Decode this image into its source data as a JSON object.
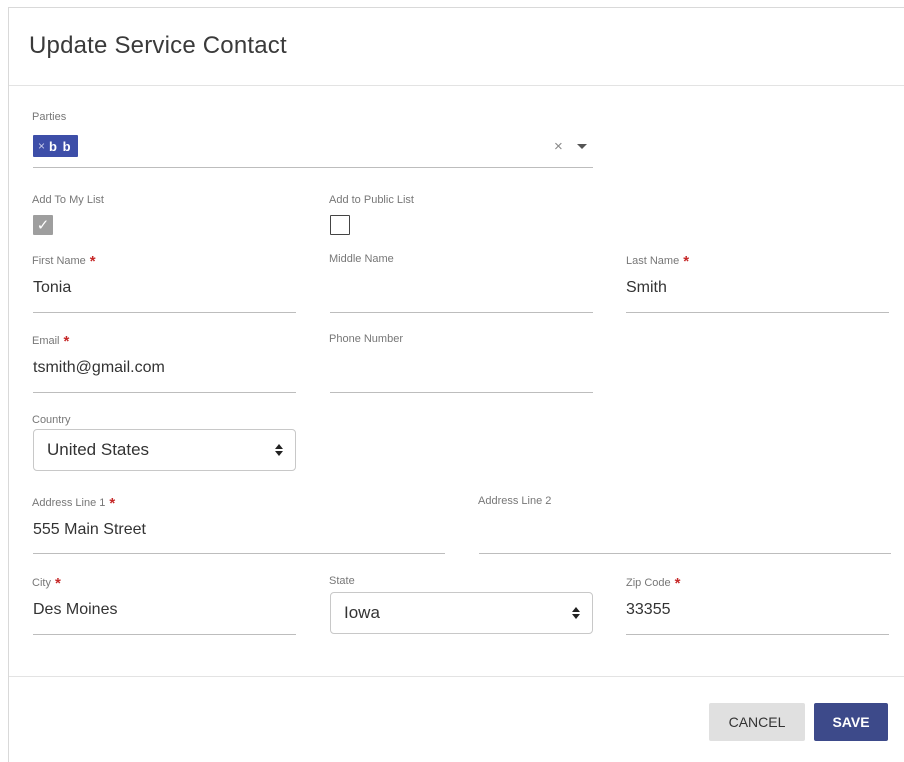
{
  "dialog": {
    "title": "Update Service Contact"
  },
  "parties": {
    "label": "Parties",
    "chips": [
      {
        "label": "b b",
        "remove_glyph": "×"
      }
    ],
    "clear_glyph": "×",
    "dropdown_icon": "caret-down-icon",
    "chip_color": "#3d4ea8"
  },
  "lists": {
    "my_list_label": "Add To My List",
    "my_list_checked": true,
    "public_list_label": "Add to Public List",
    "public_list_checked": false,
    "check_glyph": "✓"
  },
  "required_marker": "*",
  "fields": {
    "first_name": {
      "label": "First Name",
      "value": "Tonia",
      "required": true
    },
    "middle_name": {
      "label": "Middle Name",
      "value": "",
      "required": false
    },
    "last_name": {
      "label": "Last Name",
      "value": "Smith",
      "required": true
    },
    "email": {
      "label": "Email",
      "value": "tsmith@gmail.com",
      "required": true
    },
    "phone": {
      "label": "Phone Number",
      "value": "",
      "required": false
    },
    "country": {
      "label": "Country",
      "value": "United States"
    },
    "address1": {
      "label": "Address Line 1",
      "value": "555 Main Street",
      "required": true
    },
    "address2": {
      "label": "Address Line 2",
      "value": "",
      "required": false
    },
    "city": {
      "label": "City",
      "value": "Des Moines",
      "required": true
    },
    "state": {
      "label": "State",
      "value": "Iowa"
    },
    "zip": {
      "label": "Zip Code",
      "value": "33355",
      "required": true
    }
  },
  "footer": {
    "cancel_label": "CANCEL",
    "save_label": "SAVE"
  },
  "colors": {
    "primary": "#3d4a8a",
    "required": "#c62828",
    "cancel_bg": "#e0e0e0"
  }
}
